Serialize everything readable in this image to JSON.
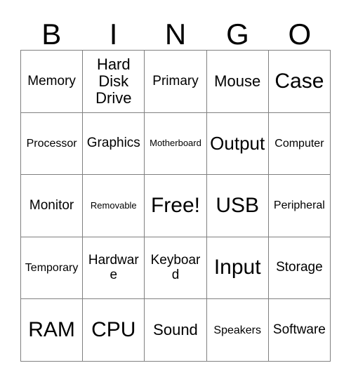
{
  "card": {
    "title": "BINGO",
    "header_letters": [
      "B",
      "I",
      "N",
      "G",
      "O"
    ],
    "columns": 5,
    "rows": 5,
    "theme": "Computer Hardware",
    "free_space_label": "Free!",
    "free_space_position": "3,3",
    "colors": {
      "background": "#ffffff",
      "text": "#000000",
      "grid_line": "#808080"
    },
    "cells": [
      [
        {
          "label": "Memory",
          "size": "md"
        },
        {
          "label": "Hard Disk Drive",
          "size": "lg"
        },
        {
          "label": "Primary",
          "size": "md"
        },
        {
          "label": "Mouse",
          "size": "lg"
        },
        {
          "label": "Case",
          "size": "xxl"
        }
      ],
      [
        {
          "label": "Processor",
          "size": "sm"
        },
        {
          "label": "Graphics",
          "size": "md"
        },
        {
          "label": "Motherboard",
          "size": "xs"
        },
        {
          "label": "Output",
          "size": "xl"
        },
        {
          "label": "Computer",
          "size": "sm"
        }
      ],
      [
        {
          "label": "Monitor",
          "size": "md"
        },
        {
          "label": "Removable",
          "size": "xs"
        },
        {
          "label": "Free!",
          "size": "xxl"
        },
        {
          "label": "USB",
          "size": "xxl"
        },
        {
          "label": "Peripheral",
          "size": "sm"
        }
      ],
      [
        {
          "label": "Temporary",
          "size": "sm"
        },
        {
          "label": "Hardware",
          "size": "md"
        },
        {
          "label": "Keyboard",
          "size": "md"
        },
        {
          "label": "Input",
          "size": "xxl"
        },
        {
          "label": "Storage",
          "size": "md"
        }
      ],
      [
        {
          "label": "RAM",
          "size": "xxl"
        },
        {
          "label": "CPU",
          "size": "xxl"
        },
        {
          "label": "Sound",
          "size": "lg"
        },
        {
          "label": "Speakers",
          "size": "sm"
        },
        {
          "label": "Software",
          "size": "md"
        }
      ]
    ]
  }
}
